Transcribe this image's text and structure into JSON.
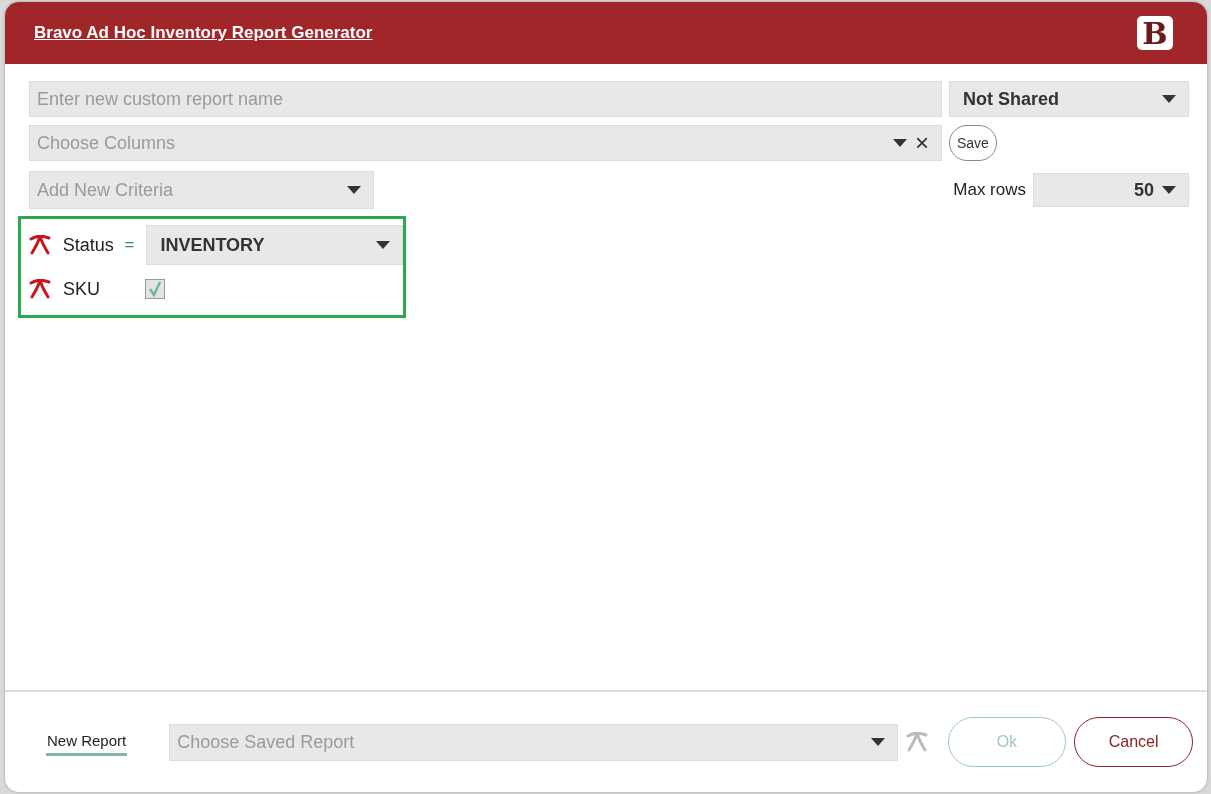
{
  "dialog": {
    "title": "Bravo Ad Hoc Inventory Report Generator",
    "logo": "B"
  },
  "report_name": {
    "placeholder": "Enter new custom report name"
  },
  "sharing": {
    "value": "Not Shared"
  },
  "columns": {
    "placeholder": "Choose Columns",
    "save_button": "Save",
    "clear_symbol": "×"
  },
  "add_criteria": {
    "placeholder": "Add New Criteria"
  },
  "max_rows": {
    "label": "Max rows",
    "value": "50"
  },
  "criteria": [
    {
      "kind": "dropdown",
      "field": "Status",
      "operator": "=",
      "value": "INVENTORY"
    },
    {
      "kind": "checkbox",
      "field": "SKU",
      "checked": true
    }
  ],
  "footer": {
    "tab": {
      "label": "New Report",
      "selected": true
    },
    "saved_report": {
      "placeholder": "Choose Saved Report"
    },
    "ok_button": {
      "label": "Ok",
      "disabled": true
    },
    "cancel_button": {
      "label": "Cancel",
      "disabled": false
    }
  }
}
